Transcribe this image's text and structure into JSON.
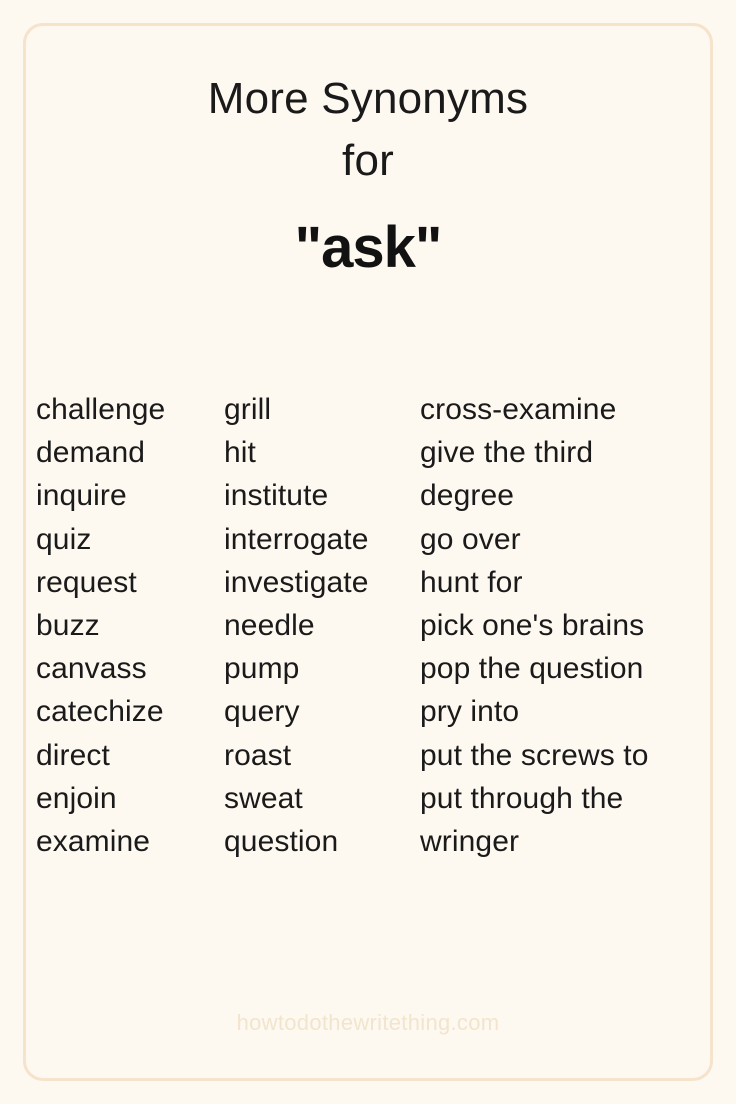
{
  "page": {
    "background_color": "#fdf8f0",
    "frame_border_color": "#f5e3cc",
    "text_color": "#1a1a1a",
    "footer_color": "#f2e5ce"
  },
  "header": {
    "line1": "More Synonyms",
    "line2": "for",
    "subject": "\"ask\""
  },
  "columns": [
    {
      "id": "column-1",
      "words": [
        "challenge",
        "demand",
        "inquire",
        "quiz",
        "request",
        "buzz",
        "canvass",
        "catechize",
        "direct",
        "enjoin",
        "examine"
      ]
    },
    {
      "id": "column-2",
      "words": [
        "grill",
        "hit",
        "institute",
        "interrogate",
        "investigate",
        "needle",
        "pump",
        "query",
        "roast",
        "sweat",
        "question"
      ]
    },
    {
      "id": "column-3",
      "words": [
        "cross-examine",
        "give the third",
        "degree",
        "go over",
        "hunt for",
        "pick one's brains",
        "pop the question",
        "pry into",
        "put the screws to",
        "put through the",
        "wringer"
      ]
    }
  ],
  "footer": {
    "watermark": "howtodothewritething.com"
  }
}
